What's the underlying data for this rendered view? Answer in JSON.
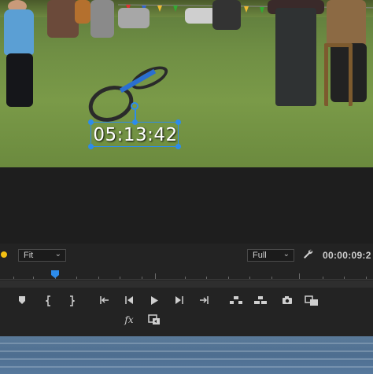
{
  "program_monitor": {
    "title_overlay": {
      "text": "05:13:42"
    },
    "zoom_select": {
      "value": "Fit"
    },
    "resolution_select": {
      "value": "Full"
    },
    "timecode": "00:00:09:2"
  },
  "icons": {
    "marker": "marker-icon",
    "mark_in": "mark-in-icon",
    "mark_out": "mark-out-icon",
    "go_to_in": "go-to-in-icon",
    "step_back": "step-back-icon",
    "play": "play-icon",
    "step_forward": "step-forward-icon",
    "go_to_out": "go-to-out-icon",
    "lift": "lift-icon",
    "extract": "extract-icon",
    "export_frame": "camera-icon",
    "comparison_view": "comparison-view-icon",
    "fx": "fx-icon",
    "proxy": "proxy-icon",
    "settings": "wrench-icon"
  },
  "colors": {
    "accent": "#2d8ceb",
    "marker_dot": "#f3c013",
    "panel_bg": "#232323"
  }
}
